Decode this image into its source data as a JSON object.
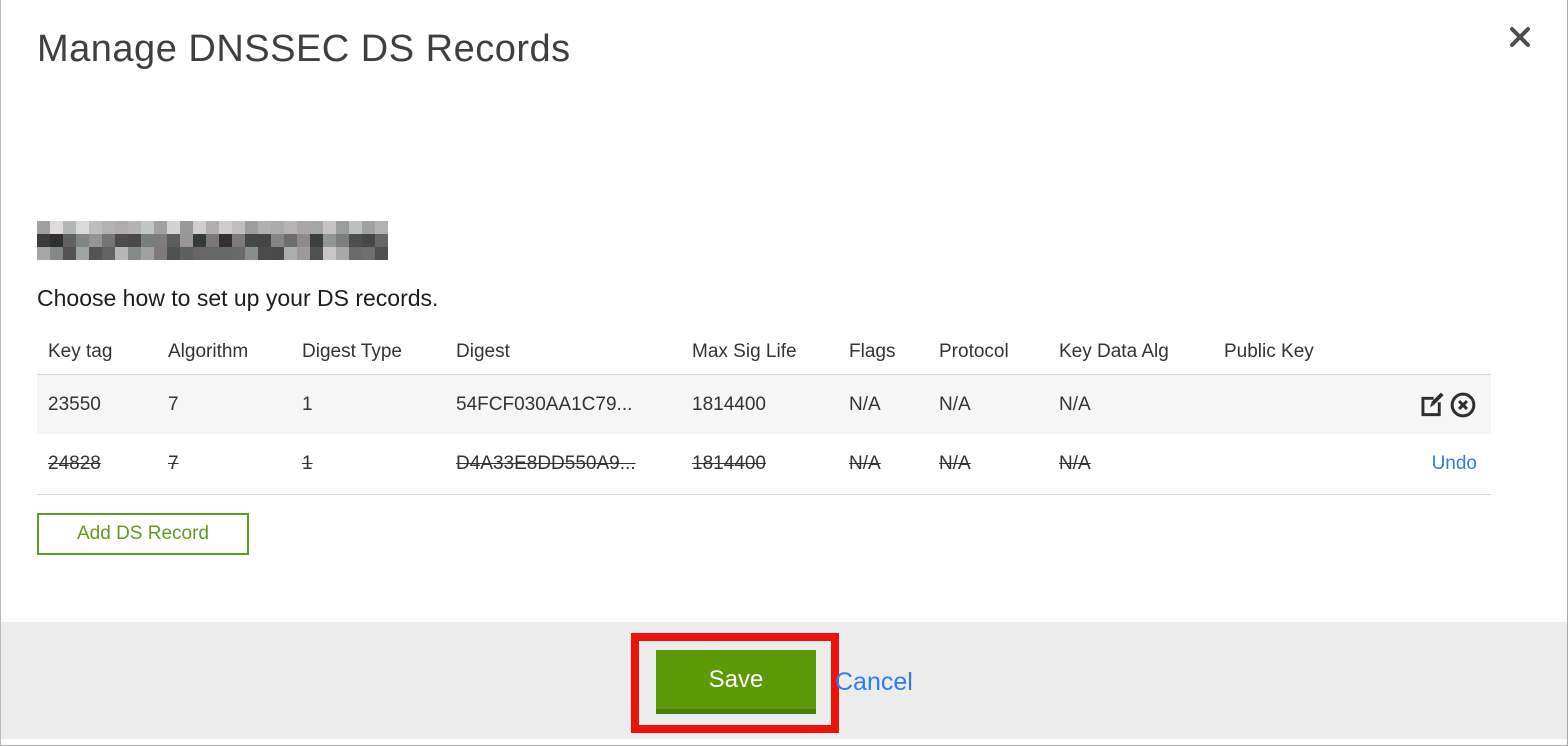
{
  "modal": {
    "title": "Manage DNSSEC DS Records",
    "subtitle": "Choose how to set up your DS records.",
    "add_button_label": "Add DS Record",
    "save_label": "Save",
    "cancel_label": "Cancel",
    "undo_label": "Undo"
  },
  "table": {
    "columns": [
      "Key tag",
      "Algorithm",
      "Digest Type",
      "Digest",
      "Max Sig Life",
      "Flags",
      "Protocol",
      "Key Data Alg",
      "Public Key"
    ],
    "rows": [
      {
        "key_tag": "23550",
        "algorithm": "7",
        "digest_type": "1",
        "digest": "54FCF030AA1C79...",
        "max_sig_life": "1814400",
        "flags": "N/A",
        "protocol": "N/A",
        "key_data_alg": "N/A",
        "public_key": "",
        "deleted": false
      },
      {
        "key_tag": "24828",
        "algorithm": "7",
        "digest_type": "1",
        "digest": "D4A33E8DD550A9...",
        "max_sig_life": "1814400",
        "flags": "N/A",
        "protocol": "N/A",
        "key_data_alg": "N/A",
        "public_key": "",
        "deleted": true
      }
    ]
  },
  "colors": {
    "save_green": "#5b9a05",
    "save_green_dark": "#4a7d06",
    "add_green": "#5f9c1d",
    "link_blue": "#2e7de0",
    "annotation_red": "#ee1309",
    "row_alt_bg": "#f6f6f6",
    "footer_bg": "#ececec"
  }
}
